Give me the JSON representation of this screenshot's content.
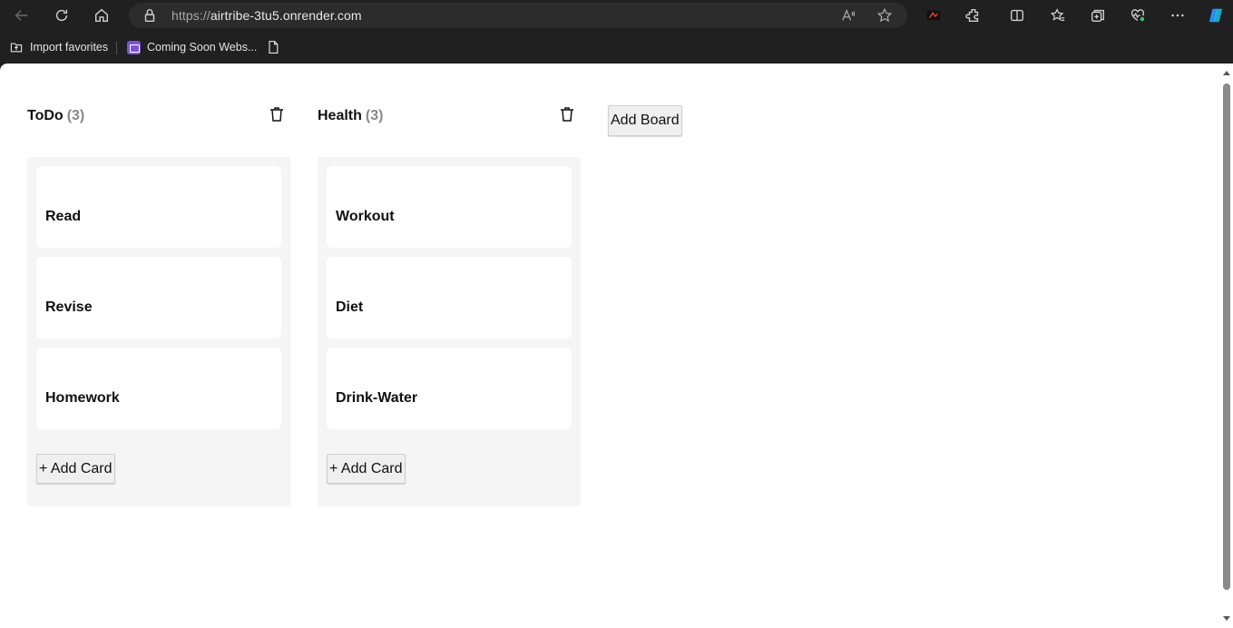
{
  "browser": {
    "url_scheme": "https://",
    "url_host": "airtribe-3tu5.onrender.com",
    "bookmarks": [
      {
        "label": "Import favorites"
      },
      {
        "label": "Coming Soon Webs..."
      }
    ]
  },
  "boards": [
    {
      "title": "ToDo",
      "count": "(3)",
      "cards": [
        "Read",
        "Revise",
        "Homework"
      ],
      "add_card_label": "+ Add Card"
    },
    {
      "title": "Health",
      "count": "(3)",
      "cards": [
        "Workout",
        "Diet",
        "Drink-Water"
      ],
      "add_card_label": "+ Add Card"
    }
  ],
  "add_board_label": "Add Board",
  "colors": {
    "board_bg": "#f5f5f5",
    "card_bg": "#ffffff",
    "count_text": "#888888",
    "chrome_bg": "#202020"
  }
}
